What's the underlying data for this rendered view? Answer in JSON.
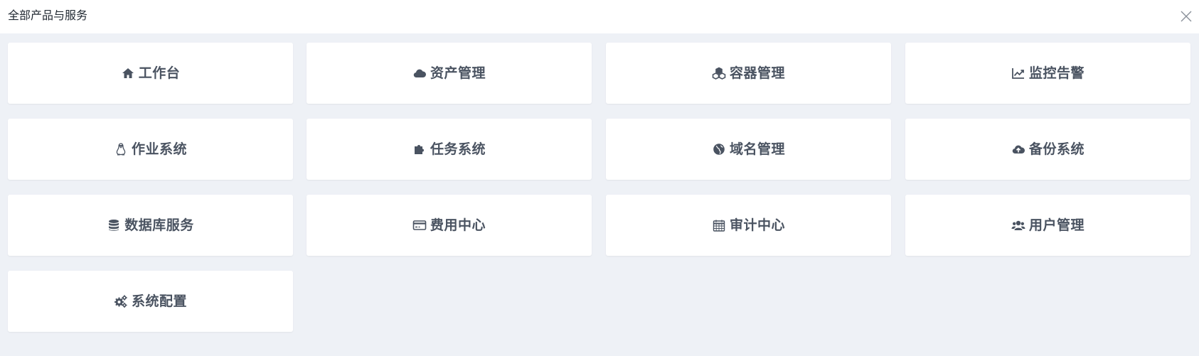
{
  "header": {
    "title": "全部产品与服务",
    "close_icon": "close-icon"
  },
  "colors": {
    "background": "#eef1f6",
    "card": "#ffffff",
    "text": "#4a5361"
  },
  "products": [
    {
      "label": "工作台",
      "icon": "home-icon"
    },
    {
      "label": "资产管理",
      "icon": "cloud-icon"
    },
    {
      "label": "容器管理",
      "icon": "cubes-icon"
    },
    {
      "label": "监控告警",
      "icon": "line-chart-icon"
    },
    {
      "label": "作业系统",
      "icon": "linux-icon"
    },
    {
      "label": "任务系统",
      "icon": "puzzle-icon"
    },
    {
      "label": "域名管理",
      "icon": "globe-icon"
    },
    {
      "label": "备份系统",
      "icon": "cloud-upload-icon"
    },
    {
      "label": "数据库服务",
      "icon": "database-icon"
    },
    {
      "label": "费用中心",
      "icon": "credit-card-icon"
    },
    {
      "label": "审计中心",
      "icon": "calendar-icon"
    },
    {
      "label": "用户管理",
      "icon": "users-icon"
    },
    {
      "label": "系统配置",
      "icon": "gears-icon"
    }
  ]
}
